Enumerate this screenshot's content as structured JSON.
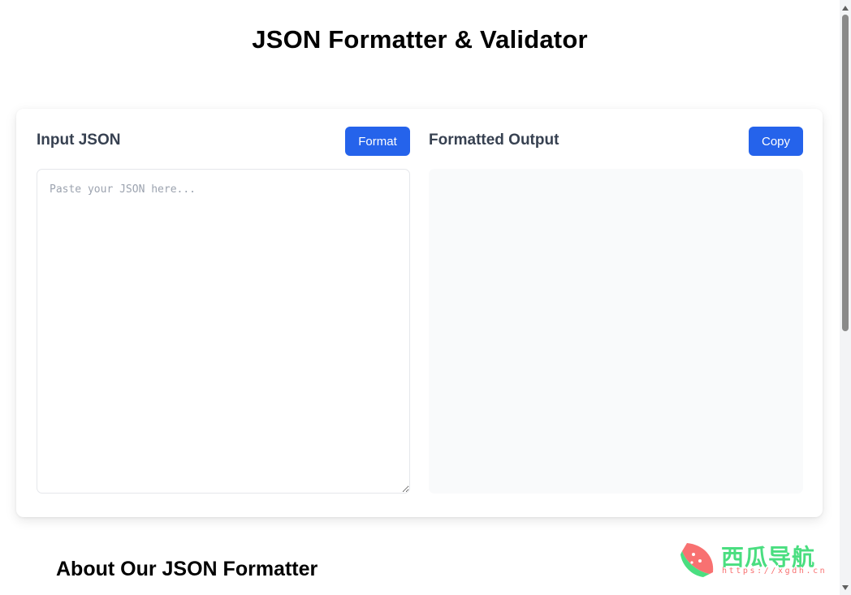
{
  "header": {
    "title": "JSON Formatter & Validator"
  },
  "input_panel": {
    "label": "Input JSON",
    "button_label": "Format",
    "placeholder": "Paste your JSON here...",
    "value": ""
  },
  "output_panel": {
    "label": "Formatted Output",
    "button_label": "Copy",
    "value": ""
  },
  "about": {
    "title": "About Our JSON Formatter"
  },
  "watermark": {
    "text": "西瓜导航",
    "url": "https://xgdh.cn"
  },
  "colors": {
    "accent": "#2563eb",
    "output_bg": "#f9fafb",
    "watermark_green": "#4ade80",
    "watermark_red": "#f87171"
  },
  "icons": {
    "watermark_logo": "watermelon-logo-icon",
    "scroll_up": "scroll-up-arrow-icon",
    "scroll_down": "scroll-down-arrow-icon"
  }
}
